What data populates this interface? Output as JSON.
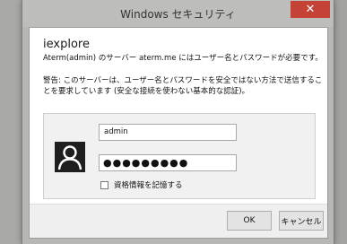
{
  "dialog": {
    "title": "Windows セキュリティ",
    "close_glyph": "✕",
    "app_name": "iexplore",
    "server_message": "Aterm(admin) のサーバー aterm.me にはユーザー名とパスワードが必要です。",
    "warning_message": "警告: このサーバーは、ユーザー名とパスワードを安全ではない方法で送信することを要求しています (安全な接続を使わない基本的な認証)。",
    "username": "admin",
    "password_mask": "●●●●●●●●●",
    "remember_label": "資格情報を記憶する",
    "remember_checked": false,
    "ok_label": "OK",
    "cancel_label": "キャンセル"
  }
}
